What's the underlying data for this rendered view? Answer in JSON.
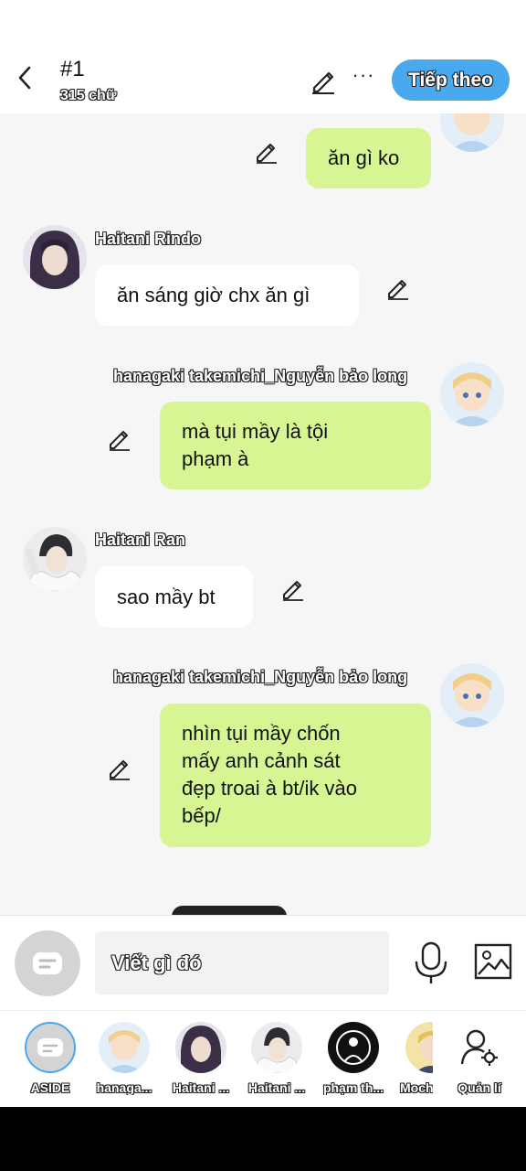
{
  "header": {
    "title": "#1",
    "word_count": "315 chữ",
    "next_label": "Tiếp theo"
  },
  "messages": [
    {
      "side": "right",
      "text": "ăn gì ko"
    },
    {
      "side": "left",
      "name": "Haitani Rindo",
      "text": "ăn sáng giờ chx ăn gì"
    },
    {
      "side": "right",
      "name": "hanagaki takemichi_Nguyễn bảo long",
      "text_lines": [
        "mà tụi mầy là tội",
        "phạm à"
      ]
    },
    {
      "side": "left",
      "name": "Haitani Ran",
      "text": "sao mầy bt"
    },
    {
      "side": "right",
      "name": "hanagaki takemichi_Nguyễn bảo long",
      "text_lines": [
        "nhìn tụi mầy chốn",
        "mấy anh cảnh sát",
        "đẹp troai à bt/ik vào",
        "bếp/"
      ]
    }
  ],
  "composer": {
    "placeholder": "Viết gì đó"
  },
  "characters": [
    {
      "label": "ASIDE"
    },
    {
      "label": "hanaga..."
    },
    {
      "label": "Haitani ..."
    },
    {
      "label": "Haitani ..."
    },
    {
      "label": "phạm th..."
    },
    {
      "label": "Moch"
    },
    {
      "label": "Quản lí"
    }
  ],
  "colors": {
    "accent": "#4aa8ef",
    "bubble_right": "#d7f693",
    "bubble_left": "#ffffff",
    "chat_background": "#f6f6f6"
  }
}
